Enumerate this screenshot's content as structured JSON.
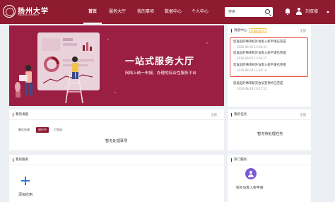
{
  "header": {
    "logo_cn": "扬州大学",
    "logo_en": "YANGZHOU UNIVERSITY",
    "nav": [
      "首页",
      "服务大厅",
      "我的事项",
      "数据中心",
      "个人中心"
    ],
    "active_index": 0,
    "search_placeholder": "搜索",
    "user_name": "刘双增"
  },
  "hero": {
    "title": "一站式服务大厅",
    "subtitle": "网络上统一申报、办理的综合性服务平台"
  },
  "messages": {
    "title": "消息中心",
    "unread_tag": "未读信息(0)",
    "more": "全部",
    "items": [
      {
        "title": "您发起的事项校外访客入校申请已完成",
        "time": "2020-09-02 13:30:31"
      },
      {
        "title": "您发起的事项校外访客入校申请已完成",
        "time": "2020-09-02 13:30:27"
      },
      {
        "title": "您发起的事项校外访客入校申请已完成",
        "time": "2020-08-28 13:30:14"
      },
      {
        "title": "您发起的事项研究会议室预约已完成",
        "time": "2020-08-28 16:27:52"
      }
    ]
  },
  "initiated": {
    "title": "我的发起",
    "more": "全部",
    "tabs": [
      "最近处理",
      "进行中",
      "已完成"
    ],
    "active_tab": 1,
    "empty_text": "暂无处理事项"
  },
  "tasks": {
    "title": "我的任务",
    "more": "全部",
    "empty_text": "暂无待处理任务"
  },
  "services": {
    "title": "我的服务",
    "add_label": "添加应用"
  },
  "hot": {
    "title": "热门服务",
    "items": [
      {
        "label": "校外访客入校申请"
      }
    ]
  },
  "colors": {
    "brand": "#8f1b30",
    "hero_bg": "#9a1f42",
    "highlight": "#e84a3b",
    "add_icon": "#2f7bd6",
    "hot_icon": "#7d58d4"
  }
}
